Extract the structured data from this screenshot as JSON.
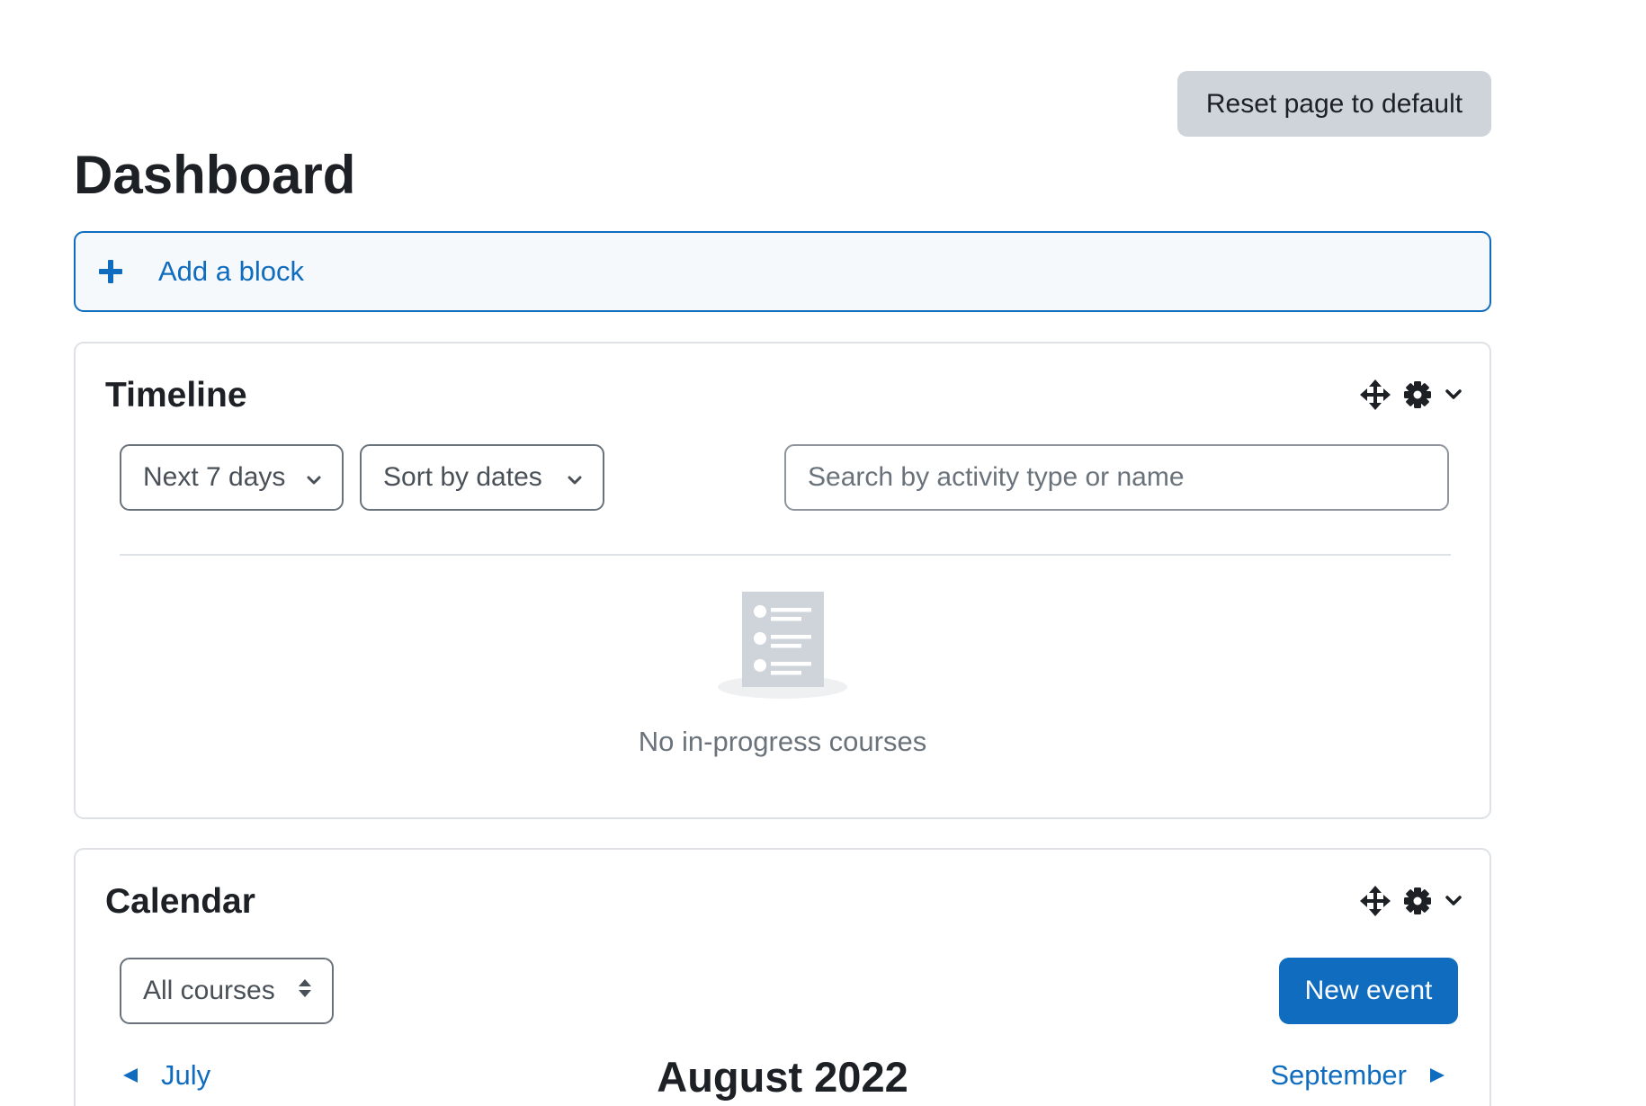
{
  "header": {
    "reset_label": "Reset page to default",
    "page_title": "Dashboard"
  },
  "add_block": {
    "label": "Add a block"
  },
  "timeline": {
    "title": "Timeline",
    "filter_label": "Next 7 days",
    "sort_label": "Sort by dates",
    "search_placeholder": "Search by activity type or name",
    "empty_message": "No in-progress courses",
    "controls": [
      "move-icon",
      "gear-icon",
      "chevron-down-icon"
    ]
  },
  "calendar": {
    "title": "Calendar",
    "course_filter": "All courses",
    "new_event_label": "New event",
    "prev_month": "July",
    "current_month": "August 2022",
    "next_month": "September",
    "controls": [
      "move-icon",
      "gear-icon",
      "chevron-down-icon"
    ]
  },
  "colors": {
    "primary": "#0f6cbf",
    "secondary_button": "#ced4da",
    "text": "#1d2125",
    "muted": "#6a737b",
    "border": "#dee2e6"
  }
}
